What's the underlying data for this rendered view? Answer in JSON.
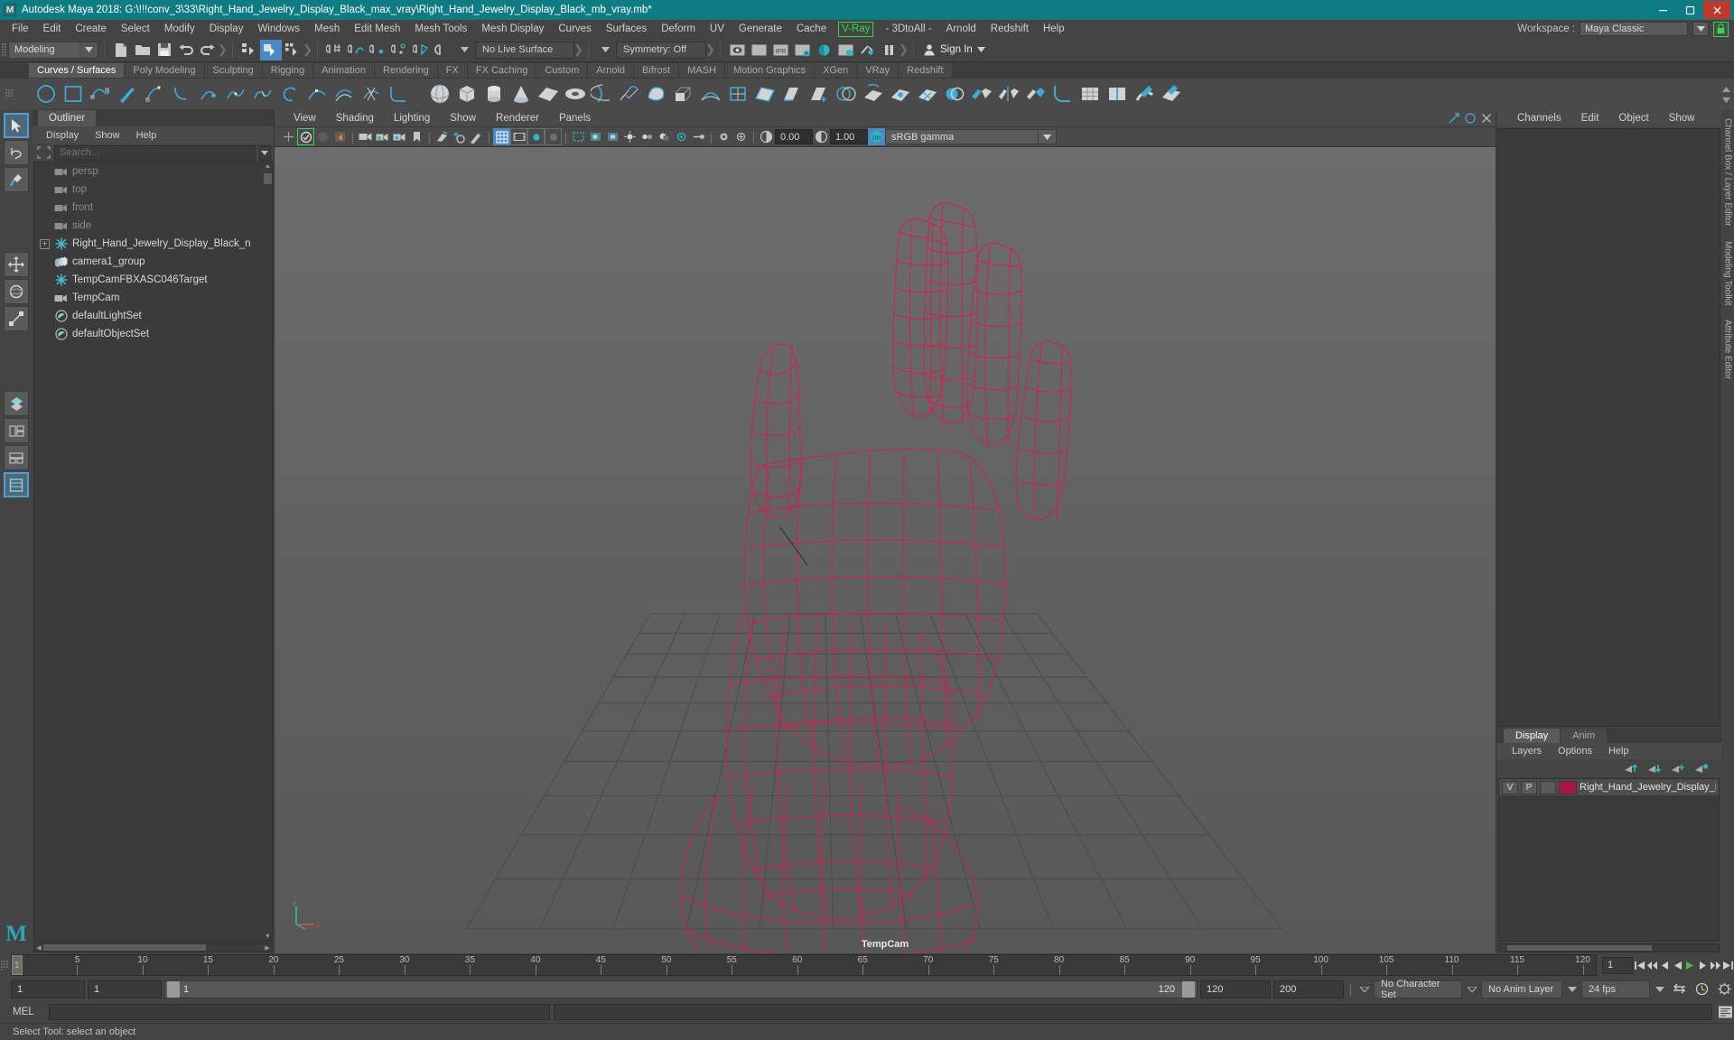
{
  "titlebar": {
    "title": "Autodesk Maya 2018: G:\\!!!conv_3\\33\\Right_Hand_Jewelry_Display_Black_max_vray\\Right_Hand_Jewelry_Display_Black_mb_vray.mb*",
    "logo_letter": "M",
    "minimize": "–",
    "maximize": "▫",
    "close": "✕",
    "accent_color": "#0e7c82"
  },
  "menubar": {
    "items": [
      "File",
      "Edit",
      "Create",
      "Select",
      "Modify",
      "Display",
      "Windows",
      "Mesh",
      "Edit Mesh",
      "Mesh Tools",
      "Mesh Display",
      "Curves",
      "Surfaces",
      "Deform",
      "UV",
      "Generate",
      "Cache"
    ],
    "highlighted_item": "V-Ray",
    "highlight_color": "#32d74b",
    "items_after": [
      "- 3DtoAll -",
      "Arnold",
      "Redshift",
      "Help"
    ],
    "workspace_label": "Workspace :",
    "workspace_value": "Maya Classic"
  },
  "statusline": {
    "mode_menu": "Modeling",
    "live_surface": "No Live Surface",
    "symmetry": "Symmetry: Off",
    "signin": "Sign In",
    "icons": [
      "new-scene-icon",
      "open-scene-icon",
      "save-scene-icon",
      "undo-icon",
      "redo-icon",
      "select-hierarchy-icon",
      "select-object-icon",
      "select-component-icon",
      "snap-grid-icon",
      "snap-curve-icon",
      "snap-point-icon",
      "snap-projected-center-icon",
      "snap-view-plane-icon",
      "magnet-icon"
    ],
    "render_icons": [
      "render-current-frame-icon",
      "render-sequence-icon",
      "ipr-render-icon",
      "render-settings-icon",
      "hypershade-icon",
      "render-view-icon",
      "render-toggle-icon",
      "pause-icon"
    ]
  },
  "shelf": {
    "tabs": [
      "Curves / Surfaces",
      "Poly Modeling",
      "Sculpting",
      "Rigging",
      "Animation",
      "Rendering",
      "FX",
      "FX Caching",
      "Custom",
      "Arnold",
      "Bifrost",
      "MASH",
      "Motion Graphics",
      "XGen",
      "VRay",
      "Redshift"
    ],
    "active_tab": "Curves / Surfaces",
    "icon_names": [
      "nurbs-circle-icon",
      "nurbs-square-icon",
      "cv-curve-tool-icon",
      "pencil-curve-tool-icon",
      "ep-curve-tool-icon",
      "bezier-curve-tool-icon",
      "arc-tool-icon",
      "attach-curves-icon",
      "detach-curves-icon",
      "open-close-curve-icon",
      "insert-knot-icon",
      "offset-curve-icon",
      "cut-curve-icon",
      "curve-fillet-icon",
      "nurbs-sphere-icon",
      "nurbs-cube-icon",
      "nurbs-cylinder-icon",
      "nurbs-cone-icon",
      "nurbs-plane-icon",
      "nurbs-torus-icon",
      "revolve-icon",
      "loft-icon",
      "planar-icon",
      "extrude-icon",
      "birail-icon",
      "boundary-icon",
      "square-surface-icon",
      "bevel-icon",
      "bevel-plus-icon",
      "intersect-surfaces-icon",
      "project-curve-icon",
      "trim-tool-icon",
      "untrim-surfaces-icon",
      "booleans-icon",
      "attach-surfaces-icon",
      "detach-surfaces-icon",
      "align-surfaces-icon",
      "surface-fillet-icon",
      "rebuild-surfaces-icon",
      "insert-isoparms-icon",
      "sculpt-geometry-icon",
      "surface-editing-icon"
    ]
  },
  "toolbox": {
    "items": [
      "select-tool",
      "lasso-select-tool",
      "paint-select-tool",
      "move-tool",
      "rotate-tool",
      "scale-tool",
      "last-tool",
      "four-view-layout",
      "two-pane-layout",
      "three-pane-layout",
      "single-pane-layout"
    ],
    "selected": "select-tool",
    "logo": "M"
  },
  "outliner": {
    "tab": "Outliner",
    "menus": [
      "Display",
      "Show",
      "Help"
    ],
    "search_placeholder": "Search...",
    "items": [
      {
        "label": "persp",
        "icon": "camera-icon",
        "dim": true,
        "expandable": false
      },
      {
        "label": "top",
        "icon": "camera-icon",
        "dim": true,
        "expandable": false
      },
      {
        "label": "front",
        "icon": "camera-icon",
        "dim": true,
        "expandable": false
      },
      {
        "label": "side",
        "icon": "camera-icon",
        "dim": true,
        "expandable": false
      },
      {
        "label": "Right_Hand_Jewelry_Display_Black_n",
        "icon": "transform-icon",
        "dim": false,
        "expandable": true
      },
      {
        "label": "camera1_group",
        "icon": "group-icon",
        "dim": false,
        "expandable": false
      },
      {
        "label": "TempCamFBXASC046Target",
        "icon": "transform-icon",
        "dim": false,
        "expandable": false
      },
      {
        "label": "TempCam",
        "icon": "camera-icon",
        "dim": false,
        "expandable": false
      },
      {
        "label": "defaultLightSet",
        "icon": "set-icon",
        "dim": false,
        "expandable": false
      },
      {
        "label": "defaultObjectSet",
        "icon": "set-icon",
        "dim": false,
        "expandable": false
      }
    ]
  },
  "viewport": {
    "menus": [
      "View",
      "Shading",
      "Lighting",
      "Show",
      "Renderer",
      "Panels"
    ],
    "camera_label": "TempCam",
    "exposure": "0.00",
    "gamma": "1.00",
    "color_management": "sRGB gamma",
    "wireframe_color": "#d81e50",
    "grid_color": "#4a4a4a",
    "background_color": "#636363",
    "toolbar_icons": [
      "select-camera-icon",
      "ipr-icon",
      "grid-snap-icon",
      "camera-icon",
      "camera-lock-icon",
      "camera-settings-icon",
      "bookmark-icon",
      "image-plane-icon",
      "2d-pan-zoom-icon",
      "grease-pencil-icon",
      "grid-toggle-icon",
      "film-gate-icon",
      "resolution-gate-icon",
      "gate-mask-icon",
      "xray-icon",
      "xray-joints-icon",
      "xray-active-components-icon",
      "exposure-icon",
      "gamma-icon",
      "color-management-icon"
    ]
  },
  "channelbox": {
    "menus": [
      "Channels",
      "Edit",
      "Object",
      "Show"
    ],
    "vertical_tabs": [
      "Channel Box / Layer Editor",
      "Modeling Toolkit",
      "Attribute Editor"
    ]
  },
  "layer_editor": {
    "tabs": [
      "Display",
      "Anim"
    ],
    "active_tab": "Display",
    "menus": [
      "Layers",
      "Options",
      "Help"
    ],
    "buttons": [
      "move-layer-up-icon",
      "move-layer-down-icon",
      "new-layer-icon",
      "new-layer-from-selected-icon"
    ],
    "rows": [
      {
        "visibility": "V",
        "playback": "P",
        "shading": "",
        "color": "#a8173f",
        "name": "Right_Hand_Jewelry_Display_B"
      }
    ]
  },
  "timeline": {
    "ticks": [
      5,
      10,
      15,
      20,
      25,
      30,
      35,
      40,
      45,
      50,
      55,
      60,
      65,
      70,
      75,
      80,
      85,
      90,
      95,
      100,
      105,
      110,
      115,
      120
    ],
    "current_frame": "1",
    "current_frame_field": "1",
    "playback_icons": [
      "go-to-start-icon",
      "step-back-keyframe-icon",
      "step-back-frame-icon",
      "play-backwards-icon",
      "play-forwards-icon",
      "step-forward-frame-icon",
      "step-forward-keyframe-icon",
      "go-to-end-icon"
    ]
  },
  "rangebar": {
    "range_start": "1",
    "anim_start": "1",
    "slider_start_label": "1",
    "slider_end_label": "120",
    "anim_end": "120",
    "range_end": "200",
    "character_set": "No Character Set",
    "anim_layer": "No Anim Layer",
    "fps": "24 fps",
    "icons": [
      "auto-keyframe-icon",
      "animation-preferences-icon",
      "playback-loop-icon"
    ]
  },
  "command_line": {
    "label": "MEL",
    "input_value": "",
    "output_value": "",
    "script-editor-icon": "script-editor-icon"
  },
  "helpline": {
    "text": "Select Tool: select an object"
  }
}
